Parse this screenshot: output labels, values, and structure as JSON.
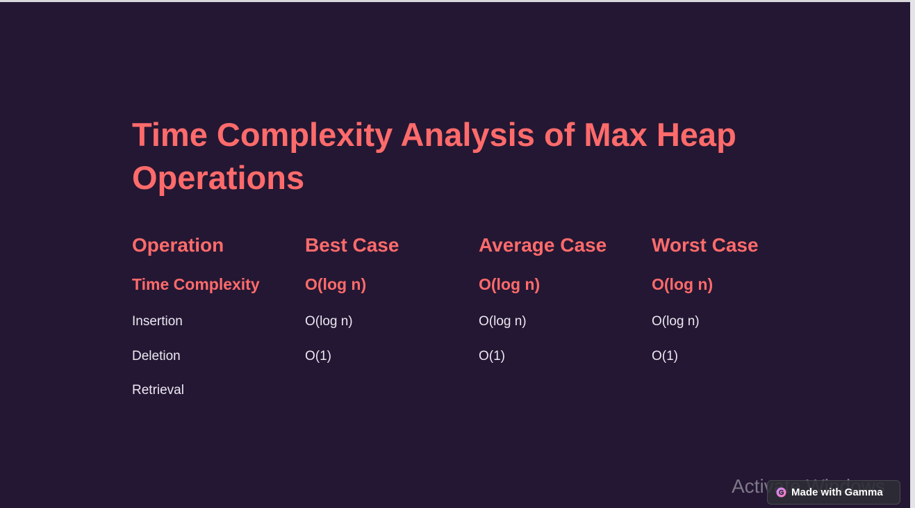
{
  "slide": {
    "title": "Time Complexity Analysis of Max Heap Operations",
    "table": {
      "header": [
        "Operation",
        "Best Case",
        "Average Case",
        "Worst Case"
      ],
      "rows": [
        [
          "Time Complexity",
          "O(log n)",
          "O(log n)",
          "O(log n)"
        ],
        [
          "Insertion",
          "O(log n)",
          "O(log n)",
          "O(log n)"
        ],
        [
          "Deletion",
          "O(1)",
          "O(1)",
          "O(1)"
        ],
        [
          "Retrieval",
          "",
          "",
          ""
        ]
      ]
    }
  },
  "badge": {
    "label": "Made with Gamma",
    "icon": "gamma-logo-icon"
  },
  "watermark": {
    "text": "Activate Windows"
  },
  "colors": {
    "background": "#241733",
    "accent": "#ff6b6b",
    "text": "#ece8f2"
  }
}
